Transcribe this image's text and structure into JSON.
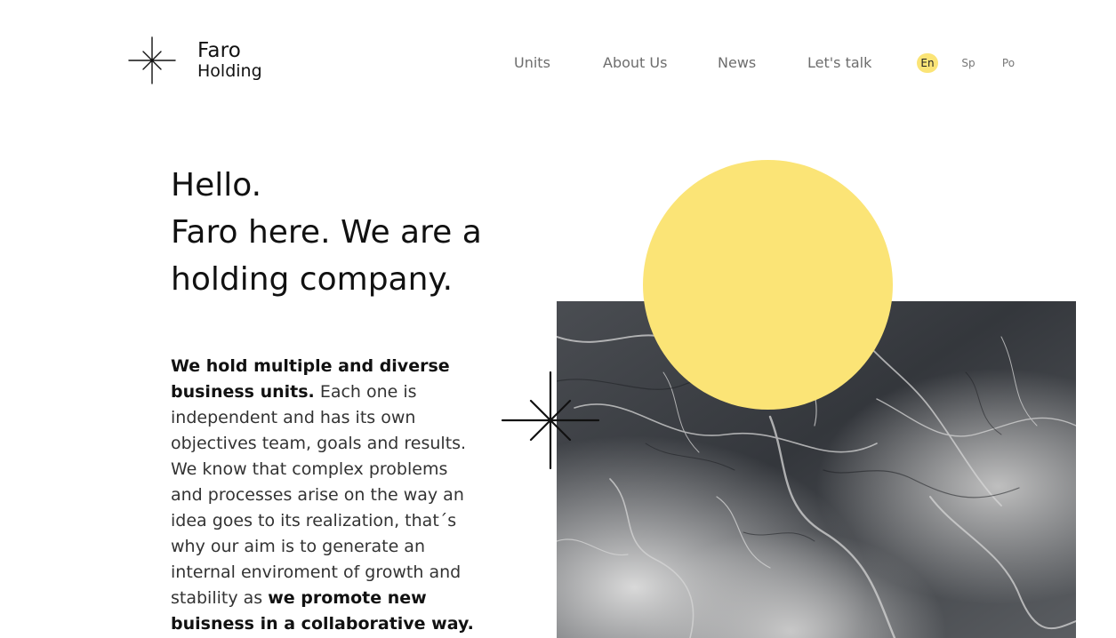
{
  "brand": {
    "name_line1": "Faro",
    "name_line2": "Holding",
    "logo_icon": "star-burst-icon"
  },
  "nav": {
    "items": [
      {
        "label": "Units"
      },
      {
        "label": "About Us"
      },
      {
        "label": "News"
      },
      {
        "label": "Let's talk"
      }
    ]
  },
  "languages": {
    "items": [
      {
        "label": "En",
        "active": true
      },
      {
        "label": "Sp",
        "active": false
      },
      {
        "label": "Po",
        "active": false
      }
    ]
  },
  "hero": {
    "headline_lines": [
      "Hello.",
      "Faro here. We are a",
      "holding company."
    ],
    "body_bold_1": "We hold multiple and diverse business units.",
    "body_regular": " Each one is independent and has its own objectives team, goals and results. We know that complex problems and processes arise on the way an idea goes to its realization, that´s why our aim is to generate an internal enviroment of growth and stability as ",
    "body_bold_2": "we promote new buisness in a collaborative way."
  },
  "colors": {
    "accent": "#fbe476",
    "text": "#111111",
    "nav_text": "#6d6d6d"
  },
  "visual": {
    "sun_icon": "sun-circle",
    "star_icon": "star-burst-icon",
    "image": "aerial-landscape-image"
  }
}
